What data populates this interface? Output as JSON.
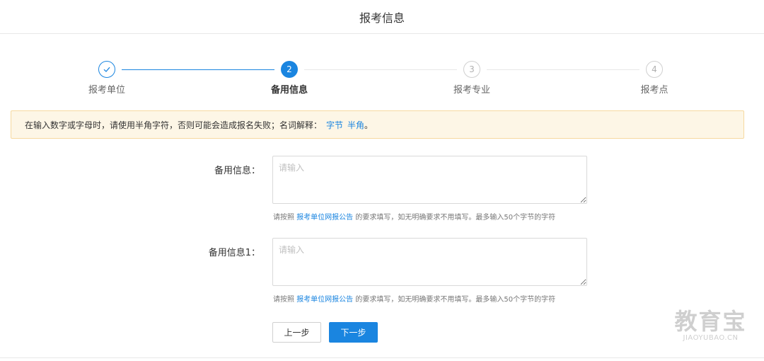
{
  "header": {
    "title": "报考信息"
  },
  "steps": [
    {
      "label": "报考单位",
      "state": "done",
      "icon": "check-icon"
    },
    {
      "label": "备用信息",
      "state": "active",
      "number": "2"
    },
    {
      "label": "报考专业",
      "state": "todo",
      "number": "3"
    },
    {
      "label": "报考点",
      "state": "todo",
      "number": "4"
    }
  ],
  "notice": {
    "text": "在输入数字或字母时，请使用半角字符，否则可能会造成报名失败；名词解释：",
    "link1": "字节",
    "link2": "半角",
    "suffix": "。"
  },
  "fields": [
    {
      "label": "备用信息：",
      "placeholder": "请输入",
      "value": "",
      "hint_prefix": "请按照 ",
      "hint_link": "报考单位网报公告",
      "hint_suffix": " 的要求填写，如无明确要求不用填写。最多输入50个字节的字符"
    },
    {
      "label": "备用信息1：",
      "placeholder": "请输入",
      "value": "",
      "hint_prefix": "请按照 ",
      "hint_link": "报考单位网报公告",
      "hint_suffix": " 的要求填写，如无明确要求不用填写。最多输入50个字节的字符"
    }
  ],
  "buttons": {
    "prev": "上一步",
    "next": "下一步"
  },
  "watermark": {
    "cn": "教育宝",
    "en": "JIAOYUBAO.CN"
  },
  "colors": {
    "accent": "#1a85e0",
    "notice_bg": "#fdf6e6",
    "notice_border": "#f6d9a0"
  }
}
